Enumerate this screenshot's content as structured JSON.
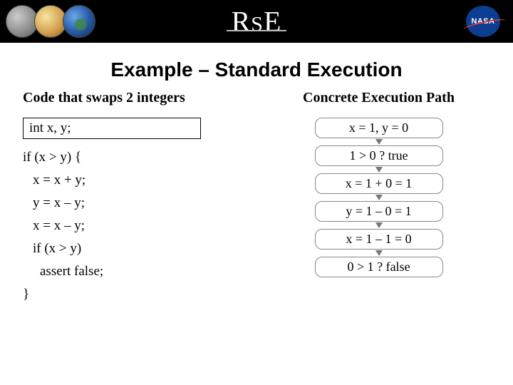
{
  "banner": {
    "logo_r": "R",
    "logo_s": "S",
    "logo_e": "E",
    "nasa_label": "NASA"
  },
  "title": "Example – Standard Execution",
  "left": {
    "heading": "Code that swaps 2 integers",
    "decl": "int x, y;",
    "lines": [
      "if (x > y) {",
      "x = x + y;",
      "y = x – y;",
      "x = x – y;",
      "if (x > y)",
      "assert false;",
      "}"
    ]
  },
  "right": {
    "heading": "Concrete Execution Path",
    "steps": [
      "x = 1, y = 0",
      "1 > 0 ? true",
      "x = 1 + 0 = 1",
      "y = 1 – 0 = 1",
      "x = 1 – 1 = 0",
      "0 > 1 ? false"
    ]
  }
}
